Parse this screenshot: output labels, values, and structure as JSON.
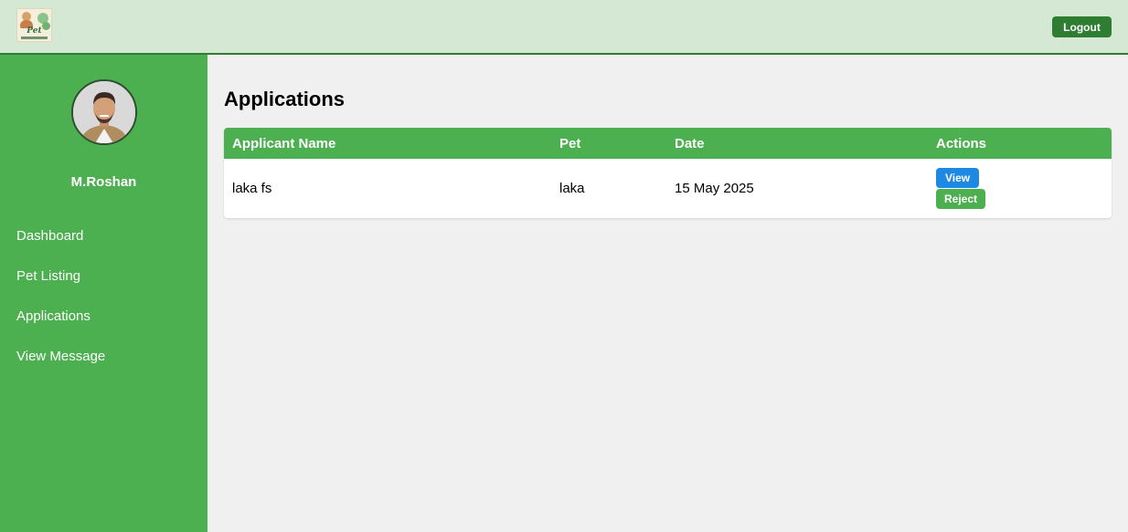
{
  "header": {
    "logo_text": "Pet",
    "logout_label": "Logout"
  },
  "sidebar": {
    "user_name": "M.Roshan",
    "items": [
      {
        "label": "Dashboard"
      },
      {
        "label": "Pet Listing"
      },
      {
        "label": "Applications"
      },
      {
        "label": "View Message"
      }
    ]
  },
  "main": {
    "title": "Applications",
    "table": {
      "columns": [
        "Applicant Name",
        "Pet",
        "Date",
        "Actions"
      ],
      "rows": [
        {
          "applicant_name": "laka fs",
          "pet": "laka",
          "date": "15 May 2025",
          "actions": {
            "view_label": "View",
            "reject_label": "Reject"
          }
        }
      ]
    }
  },
  "colors": {
    "topbar_bg": "#d4e8d4",
    "sidebar_bg": "#4caf50",
    "accent_dark": "#2e7d32",
    "view_button": "#1e88e5",
    "content_bg": "#f0f0f0"
  }
}
